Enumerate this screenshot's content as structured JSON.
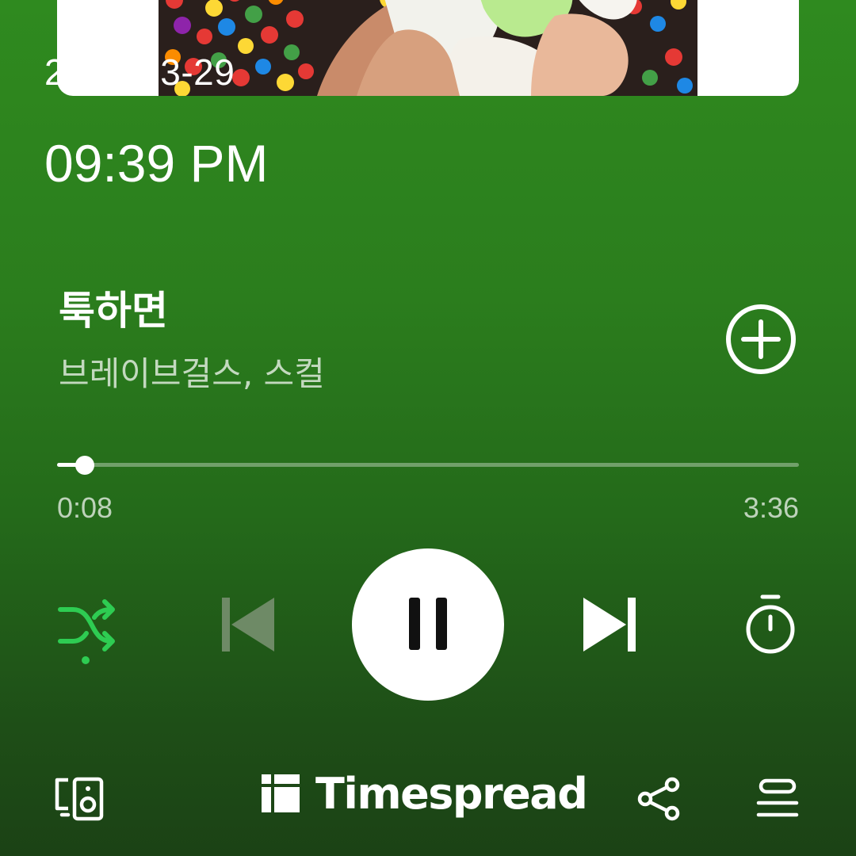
{
  "overlay": {
    "date": "2024-03-29",
    "time": "09:39 PM"
  },
  "track": {
    "title": "툭하면",
    "artist": "브레이브걸스, 스컬"
  },
  "playback": {
    "elapsed": "0:08",
    "total": "3:36",
    "progress_fraction": 0.037,
    "shuffle_on": true,
    "state": "playing"
  },
  "footer": {
    "brand": "Timespread"
  },
  "icons": {
    "add": "add-circle-icon",
    "shuffle": "shuffle-icon",
    "previous": "skip-previous-icon",
    "pause": "pause-icon",
    "next": "skip-next-icon",
    "timer": "stopwatch-icon",
    "device": "device-speaker-icon",
    "brand_logo": "timespread-logo-icon",
    "share": "share-icon",
    "queue": "queue-icon"
  },
  "colors": {
    "background_top": "#2f8a1f",
    "background_bottom": "#1b4215",
    "accent_green": "#2ecc52",
    "disabled": "#6e8a66",
    "text_primary": "#ffffff"
  }
}
